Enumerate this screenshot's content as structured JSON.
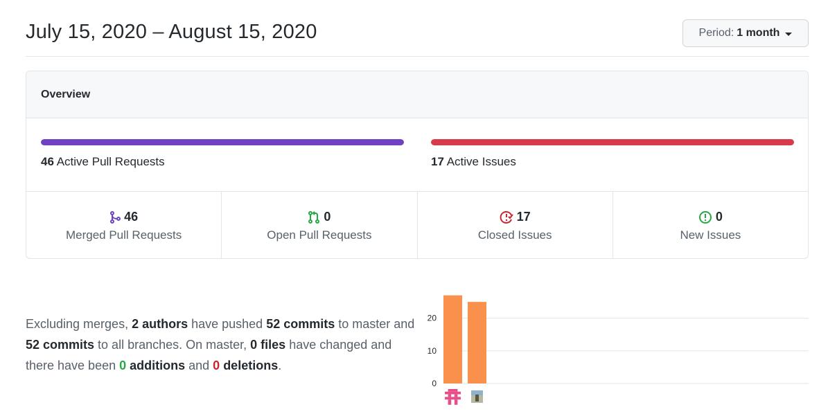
{
  "header": {
    "date_range": "July 15, 2020 – August 15, 2020",
    "period_label": "Period:",
    "period_value": "1 month"
  },
  "overview": {
    "title": "Overview",
    "pull_requests": {
      "count": "46",
      "label": "Active Pull Requests",
      "fill": 1.0,
      "color": "#6f42c1"
    },
    "issues": {
      "count": "17",
      "label": "Active Issues",
      "fill": 1.0,
      "color": "#d73a49"
    },
    "stats": [
      {
        "icon": "git-merge-icon",
        "value": "46",
        "label": "Merged Pull Requests",
        "color": "#6f42c1"
      },
      {
        "icon": "git-pull-request-icon",
        "value": "0",
        "label": "Open Pull Requests",
        "color": "#28a745"
      },
      {
        "icon": "issue-closed-icon",
        "value": "17",
        "label": "Closed Issues",
        "color": "#cb2431"
      },
      {
        "icon": "issue-opened-icon",
        "value": "0",
        "label": "New Issues",
        "color": "#28a745"
      }
    ]
  },
  "summary": {
    "p1": "Excluding merges, ",
    "authors": "2 authors",
    "p2": " have pushed ",
    "commits_master": "52 commits",
    "p3": " to master and ",
    "commits_all": "52 commits",
    "p4": " to all branches. On master, ",
    "files": "0 files",
    "p5": " have changed and there have been ",
    "additions_num": "0",
    "additions_word": " additions",
    "p6": " and ",
    "deletions_num": "0",
    "deletions_word": " deletions",
    "p7": "."
  },
  "chart_data": {
    "type": "bar",
    "categories": [
      "author-1",
      "author-2"
    ],
    "values": [
      27,
      25
    ],
    "ylim": [
      0,
      28
    ],
    "yticks": [
      "0",
      "10",
      "20"
    ],
    "bar_color": "#f9914d",
    "grid": true
  }
}
